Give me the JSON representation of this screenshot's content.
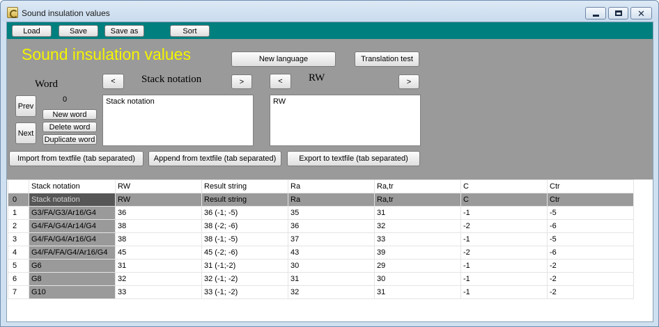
{
  "window": {
    "title": "Sound insulation values",
    "buttons": {
      "minimize": "minimize-icon",
      "maximize": "maximize-icon",
      "close": "close-icon"
    }
  },
  "toolbar": {
    "load": "Load",
    "save": "Save",
    "save_as": "Save as",
    "sort": "Sort"
  },
  "panel": {
    "title": "Sound insulation values",
    "new_language": "New language",
    "translation_test": "Translation test",
    "word_label": "Word",
    "word_counter": "0",
    "prev": "Prev",
    "next": "Next",
    "new_word": "New word",
    "delete_word": "Delete word",
    "duplicate_word": "Duplicate word",
    "left_lang": {
      "prev_arrow": "<",
      "name": "Stack notation",
      "next_arrow": ">",
      "text": "Stack notation"
    },
    "right_lang": {
      "prev_arrow": "<",
      "name": "RW",
      "next_arrow": ">",
      "text": "RW"
    },
    "import": "Import from textfile (tab separated)",
    "append": "Append from textfile (tab separated)",
    "export": "Export to textfile (tab separated)"
  },
  "colors": {
    "toolbar": "#007f7f",
    "panel": "#9a9a9a",
    "title": "#f4f400"
  },
  "grid": {
    "headers": [
      "",
      "Stack notation",
      "RW",
      "Result string",
      "Ra",
      "Ra,tr",
      "C",
      "Ctr"
    ],
    "rows": [
      [
        "0",
        "Stack notation",
        "RW",
        "Result string",
        "Ra",
        "Ra,tr",
        "C",
        "Ctr"
      ],
      [
        "1",
        "G3/FA/G3/Ar16/G4",
        "36",
        "36 (-1; -5)",
        "35",
        "31",
        "-1",
        "-5"
      ],
      [
        "2",
        "G4/FA/G4/Ar14/G4",
        "38",
        "38 (-2; -6)",
        "36",
        "32",
        "-2",
        "-6"
      ],
      [
        "3",
        "G4/FA/G4/Ar16/G4",
        "38",
        "38 (-1; -5)",
        "37",
        "33",
        "-1",
        "-5"
      ],
      [
        "4",
        "G4/FA/FA/G4/Ar16/G4",
        "45",
        "45 (-2; -6)",
        "43",
        "39",
        "-2",
        "-6"
      ],
      [
        "5",
        "G6",
        "31",
        "31 (-1;-2)",
        "30",
        "29",
        "-1",
        "-2"
      ],
      [
        "6",
        "G8",
        "32",
        "32 (-1; -2)",
        "31",
        "30",
        "-1",
        "-2"
      ],
      [
        "7",
        "G10",
        "33",
        "33 (-1; -2)",
        "32",
        "31",
        "-1",
        "-2"
      ]
    ]
  }
}
